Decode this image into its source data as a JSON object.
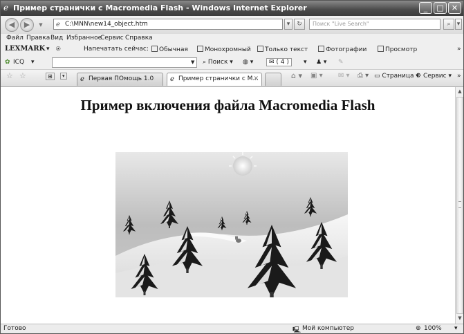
{
  "window": {
    "title": "Пример странички с Macromedia Flash - Windows Internet Explorer",
    "controls": {
      "minimize": "_",
      "maximize": "□",
      "close": "✕"
    }
  },
  "address_bar": {
    "url": "C:\\MNN\\new14_object.htm",
    "search_placeholder": "Поиск \"Live Search\""
  },
  "menu": [
    "Файл",
    "Правка",
    "Вид",
    "Избранное",
    "Сервис",
    "Справка"
  ],
  "lexmark_toolbar": {
    "logo": "LEXMARK",
    "print_now": "Напечатать сейчас:",
    "options": [
      "Обычная",
      "Монохромный",
      "Только текст",
      "Фотографии",
      "Просмотр"
    ]
  },
  "icq_toolbar": {
    "label": "ICQ",
    "search": "Поиск",
    "counter": "( 4 )"
  },
  "tabs": [
    {
      "label": "Первая ПОмощь 1.0"
    },
    {
      "label": "Пример странички с М...",
      "active": true
    }
  ],
  "command_bar": {
    "page": "Страница",
    "service": "Сервис"
  },
  "page": {
    "heading": "Пример включения файла Macromedia Flash"
  },
  "status_bar": {
    "text": "Готово",
    "zone": "Мой компьютер",
    "zoom": "100%"
  }
}
